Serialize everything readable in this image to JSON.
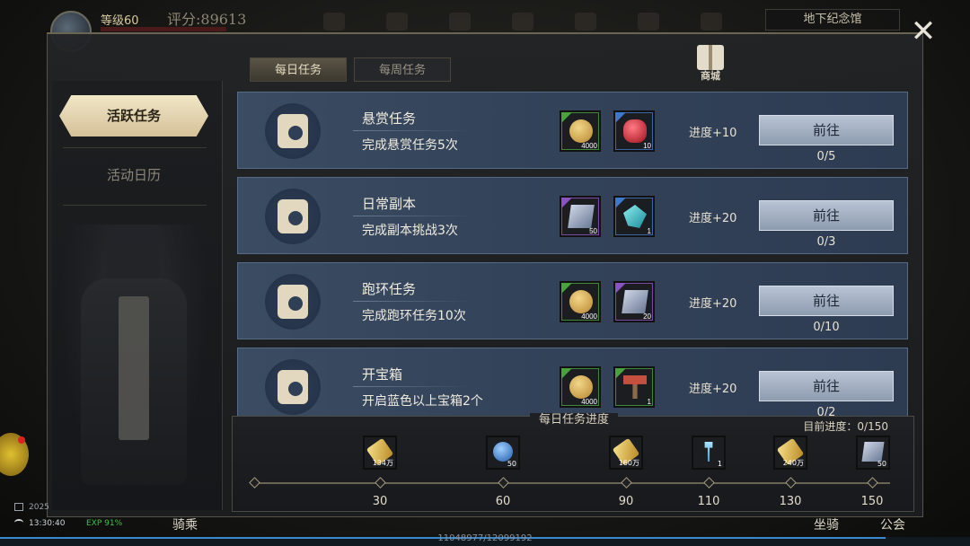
{
  "hud_top": {
    "level": "等级60",
    "score": "评分:89613",
    "location": "地下纪念馆"
  },
  "sidebar": {
    "items": [
      {
        "label": "活跃任务",
        "active": true
      },
      {
        "label": "活动日历",
        "active": false
      }
    ]
  },
  "tabs": [
    {
      "label": "每日任务",
      "active": true
    },
    {
      "label": "每周任务",
      "active": false
    }
  ],
  "shop": {
    "label": "商城",
    "icon": "gift-icon"
  },
  "tasks": [
    {
      "name": "悬赏任务",
      "desc": "完成悬赏任务5次",
      "icon": "scroll-icon",
      "rewards": [
        {
          "rarity": "green",
          "item": "coin",
          "qty": "4000"
        },
        {
          "rarity": "blue",
          "item": "gem",
          "qty": "10"
        }
      ],
      "progress": "进度+10",
      "button": "前往",
      "count": "0/5"
    },
    {
      "name": "日常副本",
      "desc": "完成副本挑战3次",
      "icon": "dungeon-icon",
      "rewards": [
        {
          "rarity": "purple",
          "item": "scroll",
          "qty": "50"
        },
        {
          "rarity": "blue",
          "item": "crystal",
          "qty": "1"
        }
      ],
      "progress": "进度+20",
      "button": "前往",
      "count": "0/3"
    },
    {
      "name": "跑环任务",
      "desc": "完成跑环任务10次",
      "icon": "loop-icon",
      "rewards": [
        {
          "rarity": "green",
          "item": "coin",
          "qty": "4000"
        },
        {
          "rarity": "purple",
          "item": "scroll",
          "qty": "20"
        }
      ],
      "progress": "进度+20",
      "button": "前往",
      "count": "0/10"
    },
    {
      "name": "开宝箱",
      "desc": "开启蓝色以上宝箱2个",
      "icon": "treasure-chest-icon",
      "rewards": [
        {
          "rarity": "green",
          "item": "coin",
          "qty": "4000"
        },
        {
          "rarity": "green",
          "item": "hammer",
          "qty": "1"
        }
      ],
      "progress": "进度+20",
      "button": "前往",
      "count": "0/2"
    }
  ],
  "daily_progress": {
    "title": "每日任务进度",
    "current": "目前进度：0/150",
    "milestones": [
      {
        "value": "30",
        "rarity": "green",
        "item": "gold",
        "qty": "134万"
      },
      {
        "value": "60",
        "rarity": "blue",
        "item": "bluegem",
        "qty": "50"
      },
      {
        "value": "90",
        "rarity": "green",
        "item": "gold",
        "qty": "160万"
      },
      {
        "value": "110",
        "rarity": "blue",
        "item": "key",
        "qty": "1"
      },
      {
        "value": "130",
        "rarity": "green",
        "item": "gold",
        "qty": "240万"
      },
      {
        "value": "150",
        "rarity": "purple",
        "item": "scroll",
        "qty": "50"
      }
    ]
  },
  "hud_bottom": {
    "date": "2025",
    "time": "13:30:40",
    "exp": "EXP 91%",
    "mount_left": "骑乘",
    "mount": "坐骑",
    "guild": "公会",
    "hp": "11048977/12099192",
    "hp_fraction": 0.913
  },
  "colors": {
    "task_bg": "#3b4c62",
    "button_bg": "#b8c4d4",
    "active_tab": "#f1e6c6",
    "rarity_green": "#4aa23e",
    "rarity_blue": "#3e78c8",
    "rarity_purple": "#8a52c2"
  }
}
